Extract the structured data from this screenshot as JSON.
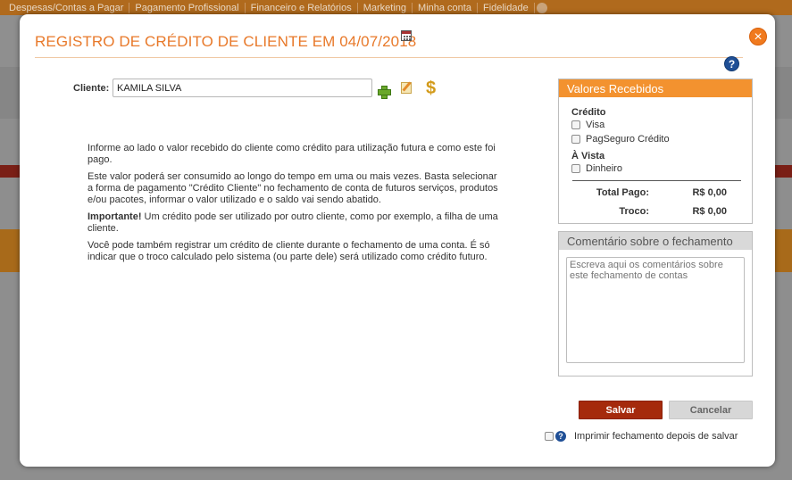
{
  "background_nav": {
    "items": [
      "Despesas/Contas a Pagar",
      "Pagamento Profissional",
      "Financeiro e Relatórios",
      "Marketing",
      "Minha conta",
      "Fidelidade"
    ]
  },
  "modal": {
    "title": "REGISTRO DE CRÉDITO DE CLIENTE EM 04/07/2018",
    "close_label": "×",
    "help_label": "?"
  },
  "client": {
    "label": "Cliente:",
    "value": "KAMILA SILVA"
  },
  "info": {
    "p1": "Informe ao lado o valor recebido do cliente como crédito para utilização futura e como este foi pago.",
    "p2": "Este valor poderá ser consumido ao longo do tempo em uma ou mais vezes. Basta selecionar a forma de pagamento \"Crédito Cliente\" no fechamento de conta de futuros serviços, produtos e/ou pacotes, informar o valor utilizado e o saldo vai sendo abatido.",
    "p3_bold": "Importante!",
    "p3_rest": " Um crédito pode ser utilizado por outro cliente, como por exemplo, a filha de uma cliente.",
    "p4": "Você pode também registrar um crédito de cliente durante o fechamento de uma conta. É só indicar que o troco calculado pelo sistema (ou parte dele) será utilizado como crédito futuro."
  },
  "values_panel": {
    "title": "Valores Recebidos",
    "credit_group": "Crédito",
    "credit_options": [
      "Visa",
      "PagSeguro Crédito"
    ],
    "cash_group": "À Vista",
    "cash_options": [
      "Dinheiro"
    ],
    "total_label": "Total Pago:",
    "total_value": "R$ 0,00",
    "change_label": "Troco:",
    "change_value": "R$ 0,00"
  },
  "comment_panel": {
    "title": "Comentário sobre o fechamento",
    "placeholder": "Escreva aqui os comentários sobre este fechamento de contas"
  },
  "actions": {
    "save": "Salvar",
    "cancel": "Cancelar",
    "print_label": "Imprimir fechamento depois de salvar"
  },
  "colors": {
    "accent": "#f3922f",
    "title": "#e8792a",
    "save": "#a52a0c"
  }
}
